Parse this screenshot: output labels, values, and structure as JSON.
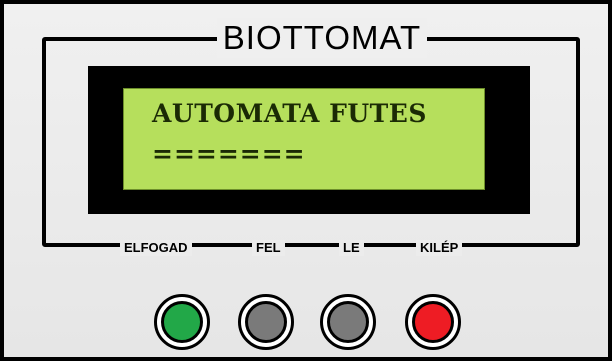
{
  "brand": {
    "title": "BIOTTOMAT"
  },
  "display": {
    "line1": "AUTOMATA FUTES",
    "line2": "=======",
    "background_color": "#b6df5c"
  },
  "buttons": [
    {
      "label": "ELFOGAD",
      "icon": "green-button-icon",
      "color": "#22a848"
    },
    {
      "label": "FEL",
      "icon": "gray-button-icon",
      "color": "#7a7a7a"
    },
    {
      "label": "LE",
      "icon": "gray-button-icon",
      "color": "#7a7a7a"
    },
    {
      "label": "KILÉP",
      "icon": "red-button-icon",
      "color": "#ee1c24"
    }
  ]
}
